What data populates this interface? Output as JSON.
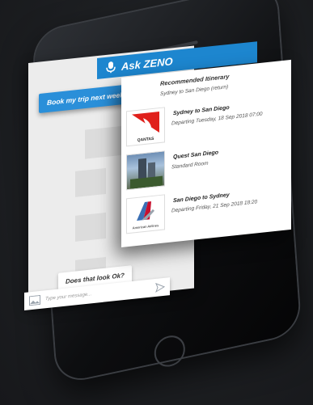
{
  "app": {
    "name": "Ask ZENO"
  },
  "chat": {
    "user_message": "Book my trip next week",
    "confirm_message": "Does that look Ok?",
    "input_placeholder": "Type your message..."
  },
  "itinerary": {
    "title": "Recommended Itinerary",
    "subtitle": "Sydney to San Diego (return)",
    "items": [
      {
        "brand": "QANTAS",
        "title": "Sydney to San Diego",
        "detail": "Departing Tuesday, 18 Sep 2018 07:00",
        "icon": "qantas-logo"
      },
      {
        "brand": "",
        "title": "Quest San Diego",
        "detail": "Standard Room",
        "icon": "hotel-photo"
      },
      {
        "brand": "American Airlines",
        "title": "San Diego to Sydney",
        "detail": "Departing Friday, 21 Sep 2018 18:20",
        "icon": "american-airlines-logo"
      }
    ]
  },
  "colors": {
    "accent": "#1d86cf",
    "bubble": "#2a8fd9",
    "qantas_red": "#e0201b",
    "aa_blue": "#3a6fb4"
  }
}
